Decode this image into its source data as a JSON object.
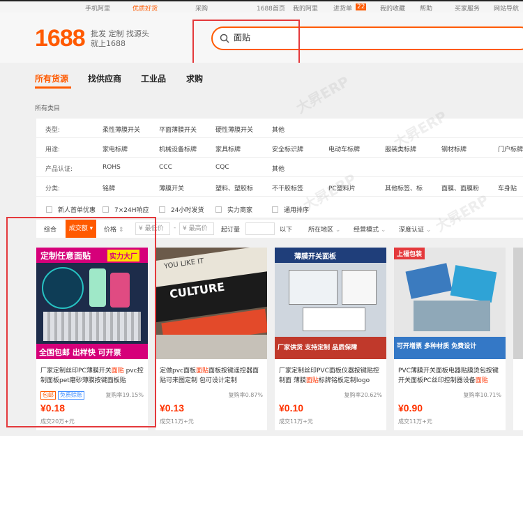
{
  "topbar": [
    "手机阿里",
    "优质好货",
    "采购",
    "1688首页",
    "我的阿里",
    "进货单",
    "我的收藏",
    "帮助",
    "买家服务",
    "网站导航"
  ],
  "topbar_badge": "22",
  "logo": {
    "number": "1688",
    "slogan_line1": "批发 定制 找源头",
    "slogan_line2": "就上1688"
  },
  "search": {
    "value": "面贴"
  },
  "nav_tabs": [
    "所有货源",
    "找供应商",
    "工业品",
    "求购"
  ],
  "breadcrumb": "所有类目",
  "filters": [
    {
      "label": "类型:",
      "options": [
        "柔性薄膜开关",
        "平面薄膜开关",
        "硬性薄膜开关",
        "其他"
      ]
    },
    {
      "label": "用途:",
      "options": [
        "家电标牌",
        "机械设备标牌",
        "家具标牌",
        "安全标识牌",
        "电动车标牌",
        "服装类标牌",
        "钢材标牌",
        "门户标牌"
      ]
    },
    {
      "label": "产品认证:",
      "options": [
        "ROHS",
        "CCC",
        "CQC",
        "其他"
      ]
    },
    {
      "label": "分类:",
      "options": [
        "铭牌",
        "薄膜开关",
        "塑料、塑胶标",
        "不干胶标签",
        "PC塑料片",
        "其他标签、标",
        "面膜、面膜粉",
        "车身贴"
      ]
    }
  ],
  "checkboxes": [
    "新人首单优惠",
    "7×24H响应",
    "24小时发货",
    "实力商家",
    "通用排序"
  ],
  "sortbar": {
    "overall": "综合",
    "volume": "成交额",
    "price": "价格",
    "min_price": "¥ 最低价",
    "dash": "-",
    "max_price": "¥ 最高价",
    "moq": "起订量",
    "moq_unit": "以下",
    "region": "所在地区",
    "mode": "经营模式",
    "cert": "深度认证"
  },
  "products": [
    {
      "img_banner_top": "定制任意面贴",
      "img_tag": "实力大厂",
      "img_banner_bottom": "全国包邮  出样快 可开票",
      "title_a": "厂家定制丝印PC薄膜开关",
      "title_hl": "面贴",
      "title_b": " pvc控制面板pet磨砂薄膜按键面板贴",
      "badge1": "包邮",
      "badge2": "免费赊账",
      "buy_rate": "复购率19.15%",
      "price": "¥0.18",
      "sold": "成交20万+元"
    },
    {
      "img_banner_top": "YOU LIKE IT",
      "img_tag": "CULTURE",
      "img_banner_bottom": "",
      "title_a": "定做pvc面板",
      "title_hl": "面贴",
      "title_b": "面板按键遥控器面贴可来图定制 包可设计定制",
      "badge1": "",
      "badge2": "",
      "buy_rate": "复购率0.87%",
      "price": "¥0.13",
      "sold": "成交11万+元"
    },
    {
      "img_banner_top": "薄膜开关面板",
      "img_tag": "",
      "img_banner_bottom": "厂家供货  支持定制 品质保障",
      "title_a": "厂家定制丝印PVC面板仪器按键贴控制面 薄膜",
      "title_hl": "面贴",
      "title_b": "标牌铭板定制logo",
      "badge1": "",
      "badge2": "",
      "buy_rate": "复购率20.62%",
      "price": "¥0.10",
      "sold": "成交11万+元"
    },
    {
      "img_banner_top": "上福包装",
      "img_tag": "",
      "img_banner_bottom": "可开增票 多种材质 免费设计",
      "title_a": "PVC薄膜开关面板电器贴膜烫包按键开关面板PC丝印控制器设备",
      "title_hl": "面贴",
      "title_b": "",
      "badge1": "",
      "badge2": "",
      "buy_rate": "复购率10.71%",
      "price": "¥0.90",
      "sold": "成交11万+元"
    }
  ],
  "watermark": "大昇ERP"
}
